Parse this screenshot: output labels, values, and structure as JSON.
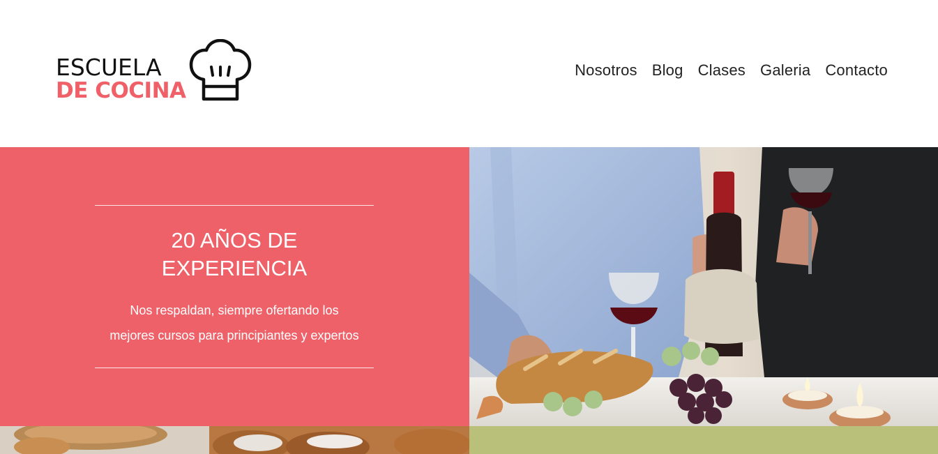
{
  "brand": {
    "line1": "ESCUELA",
    "line2": "DE COCINA",
    "icon": "chef-hat-icon",
    "accent_color": "#ef6069"
  },
  "nav": {
    "items": [
      {
        "label": "Nosotros"
      },
      {
        "label": "Blog"
      },
      {
        "label": "Clases"
      },
      {
        "label": "Galeria"
      },
      {
        "label": "Contacto"
      }
    ]
  },
  "hero": {
    "title_line1": "20 AÑOS DE",
    "title_line2": "EXPERIENCIA",
    "subtitle_line1": "Nos respaldan, siempre ofertando los",
    "subtitle_line2": "mejores cursos para principiantes y expertos",
    "panel_color": "#ef6168"
  },
  "colors": {
    "bottom_right_panel": "#b9c07a"
  }
}
